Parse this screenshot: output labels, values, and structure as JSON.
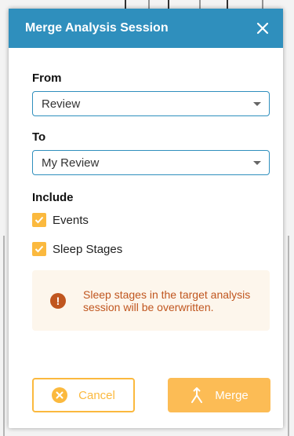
{
  "dialog": {
    "title": "Merge Analysis Session",
    "close_icon": "close-icon"
  },
  "from": {
    "label": "From",
    "selected": "Review"
  },
  "to": {
    "label": "To",
    "selected": "My Review"
  },
  "include": {
    "label": "Include",
    "options": [
      {
        "label": "Events",
        "checked": true
      },
      {
        "label": "Sleep Stages",
        "checked": true
      }
    ]
  },
  "warning": {
    "icon": "exclamation-icon",
    "text": "Sleep stages in the target analysis session will be overwritten."
  },
  "buttons": {
    "cancel_label": "Cancel",
    "cancel_icon": "cancel-circle-icon",
    "merge_label": "Merge",
    "merge_icon": "merge-icon"
  },
  "colors": {
    "header": "#2f8fbd",
    "accent": "#fbb93e",
    "warning_text": "#c0561f",
    "warning_bg": "#fdf6ec"
  }
}
